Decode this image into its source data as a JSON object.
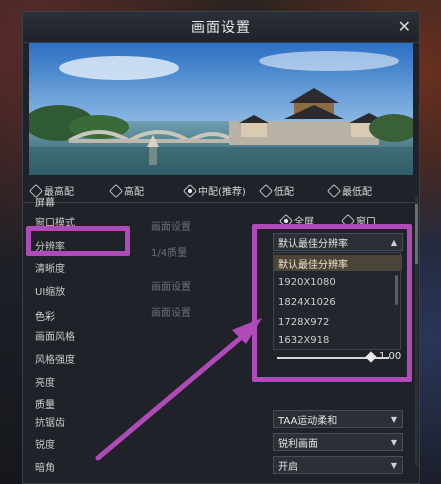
{
  "dialog": {
    "title": "画面设置"
  },
  "presets": [
    {
      "label": "最高配",
      "selected": false
    },
    {
      "label": "高配",
      "selected": false
    },
    {
      "label": "中配(推荐)",
      "selected": true
    },
    {
      "label": "低配",
      "selected": false
    },
    {
      "label": "最低配",
      "selected": false
    }
  ],
  "sections": {
    "screen": "屏幕",
    "color": "色彩",
    "quality": "质量"
  },
  "rows": {
    "window_mode": "窗口模式",
    "resolution": "分辨率",
    "clarity": "清晰度",
    "ui_scale": "UI缩放",
    "style": "画面风格",
    "style_strength": "风格强度",
    "brightness": "亮度",
    "antialias": "抗锯齿",
    "sharpness": "锐度",
    "vignette": "暗角"
  },
  "window_mode_options": {
    "fullscreen": "全屏",
    "windowed": "窗口"
  },
  "resolution_dropdown": {
    "value": "默认最佳分辨率",
    "options": [
      "默认最佳分辨率",
      "1920X1080",
      "1824X1026",
      "1728X972",
      "1632X918"
    ]
  },
  "style_strength": {
    "value": "1.00",
    "fraction": 1.0
  },
  "antialias": {
    "value": "TAA运动柔和"
  },
  "sharpness": {
    "value": "锐利画面"
  },
  "vignette": {
    "value": "开启"
  },
  "ghost_labels": [
    "画面设置",
    "1/4质量",
    "画面设置",
    "画面设置"
  ],
  "colors": {
    "annotation": "#b04ab9",
    "panel": "#1f2329",
    "selected_option": "#4a4538"
  }
}
